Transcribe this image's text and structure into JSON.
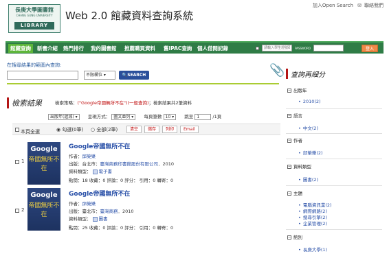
{
  "header": {
    "logo": {
      "cn": "長庚大學圖書館",
      "en": "CHANG GUNG UNIVERSITY",
      "lib": "LIBRARY"
    },
    "title": "Web 2.0 館藏資料查詢系統",
    "links": [
      "加入Open Search",
      "聯絡我們"
    ]
  },
  "nav": {
    "items": [
      "館藏查詢",
      "新書介紹",
      "熱門排行",
      "我的圖書館",
      "推薦購買資料",
      "舊IPAC查詢",
      "個人借閱記錄"
    ],
    "login_placeholder": "請輸入學生證號碼",
    "password_label": "PASSWORD",
    "login_button": "登入"
  },
  "search": {
    "label": "在搜尋結果的範圍內查詢:",
    "field_select": "不限欄位",
    "button": "SEARCH"
  },
  "results": {
    "heading": "檢索結果",
    "strategy_prefix": "檢索策略：",
    "strategy_query": "(\"Google帝國無所不在\")(一般查詢)",
    "strategy_suffix": "；檢索結果共2筆資料",
    "sort_select": "出版年(遞減)",
    "display_label": "呈現方式：",
    "display_select": "圖文並列",
    "per_page_label": "每頁筆數",
    "per_page_select": "10",
    "jump_label": "跳至",
    "jump_value": "1",
    "jump_suffix": "/1頁",
    "select_page": "本頁全選",
    "radio_checked": "勾選(0筆)",
    "radio_all": "全部(2筆)",
    "actions": [
      "清空",
      "儲存",
      "列印",
      "Email"
    ],
    "items": [
      {
        "num": "1",
        "cover_g": "Google",
        "cover_c": "帝國無所不在",
        "title": "Google帝國無所不在",
        "author_label": "作者：",
        "author": "邱榮樂",
        "pub_label": "出版：",
        "pub_place": "台北市：",
        "publisher": "臺灣商務印書館股份有限公司",
        "year": "．2010",
        "type_label": "資料類型：",
        "type": "電子書",
        "stats": "點閱：18  收藏：0  評論：0  評分：  引用：0  轉寄：0"
      },
      {
        "num": "2",
        "cover_g": "Google",
        "cover_c": "帝國無所不在",
        "title": "Google帝國無所不在",
        "author_label": "作者：",
        "author": "邱榮樂",
        "pub_label": "出版：",
        "pub_place": "臺北市：",
        "publisher": "臺灣商務",
        "year": "．2010",
        "type_label": "資料類型：",
        "type": "圖書",
        "stats": "點閱：25  收藏：0  評論：0  評分：  引用：0  轉寄：0"
      }
    ]
  },
  "sidebar": {
    "title": "查詢再細分",
    "sections": [
      {
        "label": "出版年",
        "items": [
          "2010(2)"
        ]
      },
      {
        "label": "語言",
        "items": [
          "中文(2)"
        ]
      },
      {
        "label": "作者",
        "items": [
          "邱榮樂(2)"
        ]
      },
      {
        "label": "資料類型",
        "items": [
          "圖書(2)"
        ]
      },
      {
        "label": "主題",
        "items": [
          "電腦資訊業(2)",
          "網際網路(2)",
          "搜尋引擎(2)",
          "企業管理(2)"
        ]
      },
      {
        "label": "館別",
        "items": [
          "長庚大學(1)"
        ]
      }
    ]
  }
}
